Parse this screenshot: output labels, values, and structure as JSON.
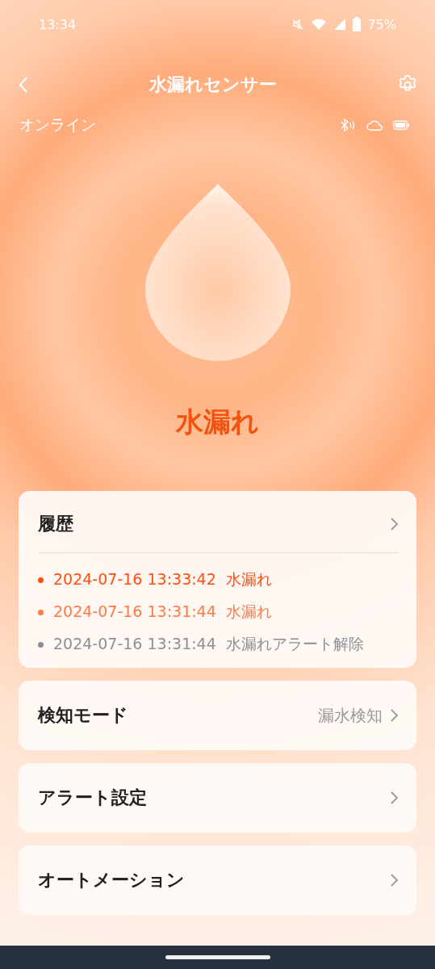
{
  "status_bar": {
    "time": "13:34",
    "battery": "75%"
  },
  "header": {
    "title": "水漏れセンサー"
  },
  "connection": {
    "status": "オンライン"
  },
  "sensor": {
    "state": "水漏れ"
  },
  "history": {
    "title": "履歴",
    "entries": [
      {
        "time": "2024-07-16 13:33:42",
        "event": "水漏れ",
        "color": "#ff4f0f"
      },
      {
        "time": "2024-07-16 13:31:44",
        "event": "水漏れ",
        "color": "#ff7a45"
      },
      {
        "time": "2024-07-16 13:31:44",
        "event": "水漏れアラート解除",
        "color": "#8e8e93"
      }
    ]
  },
  "settings": [
    {
      "label": "検知モード",
      "value": "漏水検知"
    },
    {
      "label": "アラート設定"
    },
    {
      "label": "オートメーション"
    }
  ]
}
